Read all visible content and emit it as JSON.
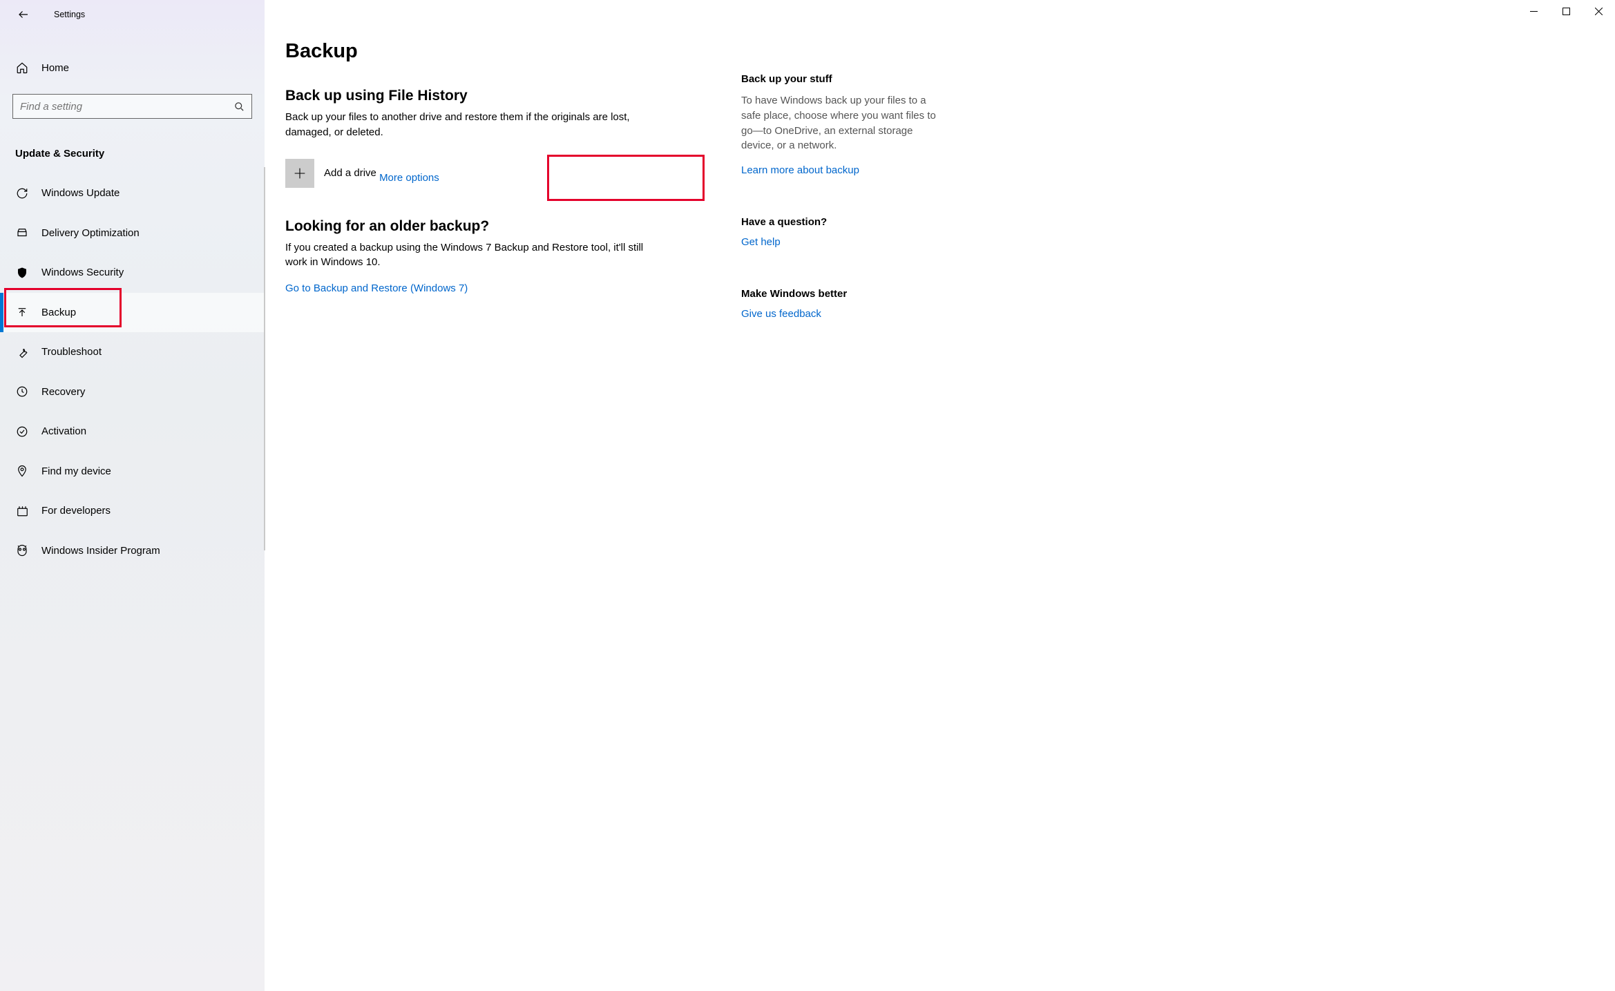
{
  "app_title": "Settings",
  "home_label": "Home",
  "search_placeholder": "Find a setting",
  "category": "Update & Security",
  "nav": [
    {
      "label": "Windows Update"
    },
    {
      "label": "Delivery Optimization"
    },
    {
      "label": "Windows Security"
    },
    {
      "label": "Backup"
    },
    {
      "label": "Troubleshoot"
    },
    {
      "label": "Recovery"
    },
    {
      "label": "Activation"
    },
    {
      "label": "Find my device"
    },
    {
      "label": "For developers"
    },
    {
      "label": "Windows Insider Program"
    }
  ],
  "main": {
    "title": "Backup",
    "section1_h": "Back up using File History",
    "section1_body": "Back up your files to another drive and restore them if the originals are lost, damaged, or deleted.",
    "add_drive_label": "Add a drive",
    "more_options": "More options",
    "section2_h": "Looking for an older backup?",
    "section2_body": "If you created a backup using the Windows 7 Backup and Restore tool, it'll still work in Windows 10.",
    "goto_link": "Go to Backup and Restore (Windows 7)"
  },
  "right": {
    "b1_h": "Back up your stuff",
    "b1_body": "To have Windows back up your files to a safe place, choose where you want files to go—to OneDrive, an external storage device, or a network.",
    "b1_link": "Learn more about backup",
    "b2_h": "Have a question?",
    "b2_link": "Get help",
    "b3_h": "Make Windows better",
    "b3_link": "Give us feedback"
  }
}
